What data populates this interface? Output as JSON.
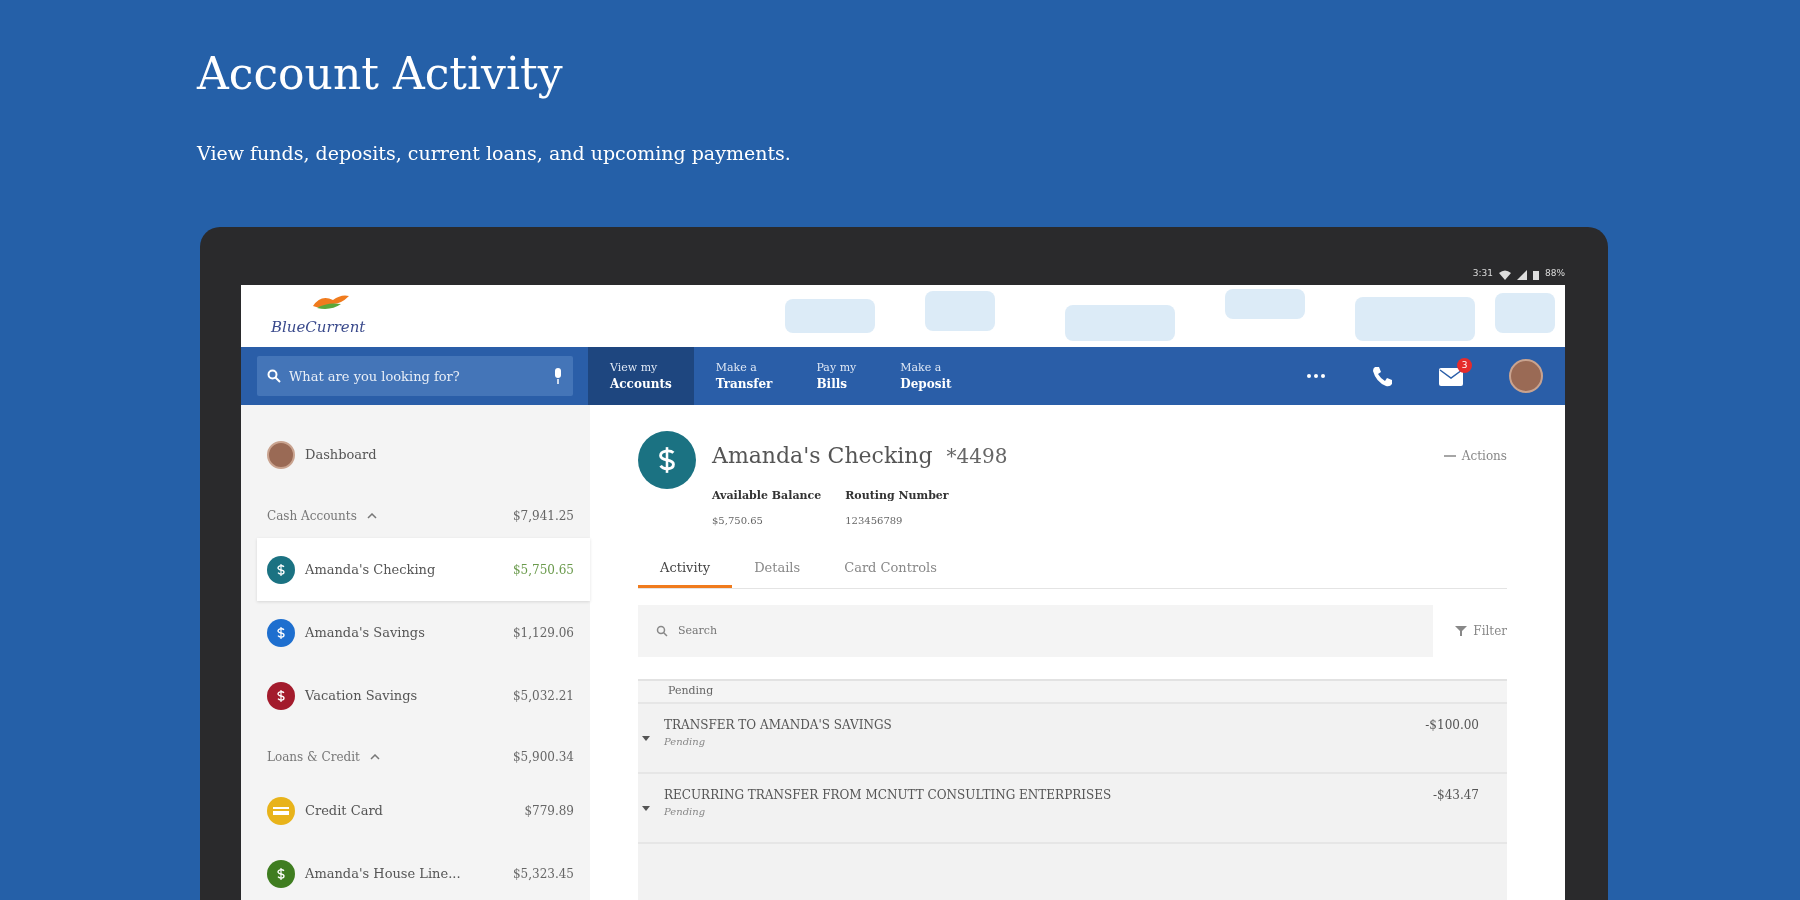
{
  "headline": "Account Activity",
  "subtitle": "View funds, deposits, current loans, and upcoming payments.",
  "device": {
    "status_time": "3:31",
    "battery": "88%"
  },
  "app": {
    "logo_text": "BlueCurrent",
    "search": {
      "placeholder": "What are you looking for?"
    },
    "nav_tabs": [
      {
        "line1": "View my",
        "line2": "Accounts",
        "selected": true
      },
      {
        "line1": "Make a",
        "line2": "Transfer",
        "selected": false
      },
      {
        "line1": "Pay my",
        "line2": "Bills",
        "selected": false
      },
      {
        "line1": "Make a",
        "line2": "Deposit",
        "selected": false
      }
    ],
    "mail_badge": "3",
    "sidebar": [
      {
        "kind": "link",
        "label": "Dashboard"
      },
      {
        "kind": "group",
        "label": "Cash Accounts",
        "total": "$7,941.25",
        "expanded": true
      },
      {
        "kind": "account",
        "label": "Amanda's Checking",
        "amount": "$5,750.65",
        "color": "#1b7282",
        "selected": true
      },
      {
        "kind": "account",
        "label": "Amanda's Savings",
        "amount": "$1,129.06",
        "color": "#1e6fcf",
        "selected": false
      },
      {
        "kind": "account",
        "label": "Vacation Savings",
        "amount": "$5,032.21",
        "color": "#a31b2c",
        "selected": false
      },
      {
        "kind": "group",
        "label": "Loans & Credit",
        "total": "$5,900.34",
        "expanded": true
      },
      {
        "kind": "card",
        "label": "Credit Card",
        "amount": "$779.89",
        "color": "#e8b31a",
        "selected": false
      },
      {
        "kind": "account",
        "label": "Amanda's House Line...",
        "amount": "$5,323.45",
        "color": "#3f7d20",
        "selected": false
      }
    ],
    "account": {
      "name": "Amanda's Checking",
      "number": "*4498",
      "actions": "Actions",
      "fields": [
        {
          "label": "Available Balance",
          "value": "$5,750.65"
        },
        {
          "label": "Routing Number",
          "value": "123456789"
        }
      ],
      "tabs": [
        {
          "label": "Activity",
          "selected": true
        },
        {
          "label": "Details",
          "selected": false
        },
        {
          "label": "Card Controls",
          "selected": false
        }
      ],
      "search": {
        "placeholder": "Search"
      },
      "filter": "Filter",
      "section": "Pending",
      "transactions": [
        {
          "description": "TRANSFER TO AMANDA'S SAVINGS",
          "status": "Pending",
          "amount": "-$100.00"
        },
        {
          "description": "RECURRING TRANSFER FROM MCNUTT CONSULTING ENTERPRISES",
          "status": "Pending",
          "amount": "-$43.47"
        }
      ]
    }
  }
}
